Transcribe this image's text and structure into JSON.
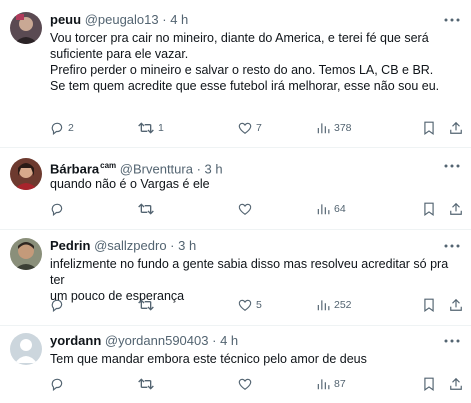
{
  "tweets": [
    {
      "name": "peuu",
      "badge": "",
      "handle": "@peugalo13",
      "dot": "·",
      "time": "4 h",
      "lines": [
        "Vou torcer pra cair no mineiro, diante do America, e terei fé que será",
        "suficiente para ele vazar.",
        "Prefiro perder o mineiro e salvar o resto do ano. Temos LA, CB e BR.",
        "",
        "Se tem quem acredite que esse futebol irá melhorar, esse não sou eu."
      ],
      "replies": "2",
      "retweets": "1",
      "likes": "7",
      "views": "378"
    },
    {
      "name": "Bárbara",
      "badge": "cam",
      "handle": "@Brventtura",
      "dot": "·",
      "time": "3 h",
      "lines": [
        "quando não é o Vargas é ele"
      ],
      "replies": "",
      "retweets": "",
      "likes": "",
      "views": "64"
    },
    {
      "name": "Pedrin",
      "badge": "",
      "handle": "@sallzpedro",
      "dot": "·",
      "time": "3 h",
      "lines": [
        "infelizmente no fundo a gente sabia disso mas resolveu acreditar só pra ter",
        "um pouco de esperança"
      ],
      "replies": "",
      "retweets": "",
      "likes": "5",
      "views": "252"
    },
    {
      "name": "yordann",
      "badge": "",
      "handle": "@yordann590403",
      "dot": "·",
      "time": "4 h",
      "lines": [
        "Tem que mandar embora este técnico pelo amor de deus"
      ],
      "replies": "",
      "retweets": "",
      "likes": "",
      "views": "87"
    }
  ],
  "icons": {
    "reply": "reply-icon",
    "retweet": "retweet-icon",
    "like": "heart-icon",
    "views": "views-icon",
    "bookmark": "bookmark-icon",
    "share": "share-icon",
    "more": "more-icon"
  },
  "colors": {
    "text": "#0f1419",
    "muted": "#536471",
    "divider": "#eff3f4"
  }
}
